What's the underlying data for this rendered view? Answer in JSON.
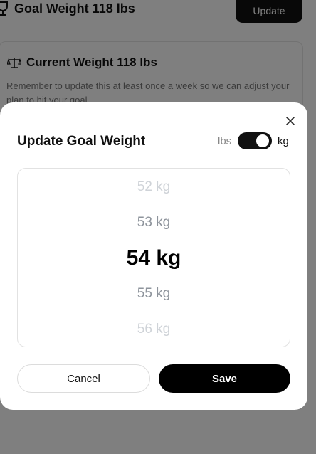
{
  "background": {
    "goal": {
      "title": "Goal Weight 118 lbs",
      "icon": "trophy-icon",
      "update_label": "Update"
    },
    "current": {
      "title": "Current Weight 118 lbs",
      "icon": "scale-icon",
      "description": "Remember to update this at least once a week so we can adjust your plan to hit your goal"
    }
  },
  "modal": {
    "title": "Update Goal Weight",
    "close_icon": "close-icon",
    "unit_toggle": {
      "left_label": "lbs",
      "right_label": "kg",
      "selected": "kg"
    },
    "picker": {
      "items": [
        "52 kg",
        "53 kg",
        "54 kg",
        "55 kg",
        "56 kg"
      ],
      "selected": "54 kg"
    },
    "cancel_label": "Cancel",
    "save_label": "Save"
  },
  "colors": {
    "accent": "#000000",
    "overlay": "rgba(0,0,0,0.5)",
    "muted_text": "#8e949c"
  }
}
